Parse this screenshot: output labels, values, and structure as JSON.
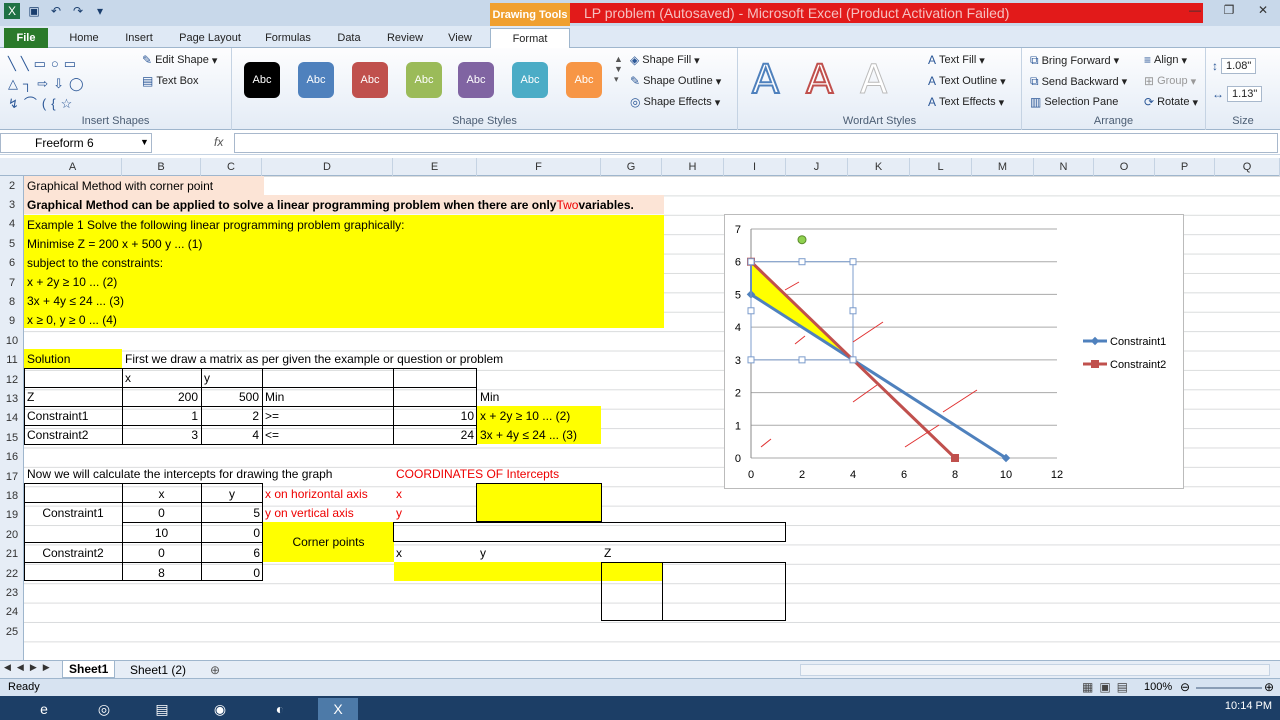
{
  "title": {
    "drawing_tools": "Drawing Tools",
    "window": "LP problem (Autosaved) - Microsoft Excel (Product Activation Failed)"
  },
  "tabs": [
    "File",
    "Home",
    "Insert",
    "Page Layout",
    "Formulas",
    "Data",
    "Review",
    "View",
    "Format"
  ],
  "ribbon": {
    "insert_shapes": {
      "label": "Insert Shapes",
      "edit_shape": "Edit Shape",
      "text_box": "Text Box"
    },
    "shape_styles": {
      "label": "Shape Styles",
      "samples": [
        "Abc",
        "Abc",
        "Abc",
        "Abc",
        "Abc",
        "Abc",
        "Abc"
      ],
      "colors": [
        "#000000",
        "#4f81bd",
        "#c0504d",
        "#9bbb59",
        "#8064a2",
        "#4bacc6",
        "#f79646"
      ],
      "shape_fill": "Shape Fill",
      "shape_outline": "Shape Outline",
      "shape_effects": "Shape Effects"
    },
    "wordart": {
      "label": "WordArt Styles",
      "text_fill": "Text Fill",
      "text_outline": "Text Outline",
      "text_effects": "Text Effects"
    },
    "arrange": {
      "label": "Arrange",
      "bring_forward": "Bring Forward",
      "send_backward": "Send Backward",
      "selection_pane": "Selection Pane",
      "align": "Align",
      "group": "Group",
      "rotate": "Rotate"
    },
    "size": {
      "label": "Size",
      "height": "1.08\"",
      "width": "1.13\""
    }
  },
  "namebox": "Freeform 6",
  "fx": "fx",
  "columns": [
    "A",
    "B",
    "C",
    "D",
    "E",
    "F",
    "G",
    "H",
    "I",
    "J",
    "K",
    "L",
    "M",
    "N",
    "O",
    "P",
    "Q"
  ],
  "rows": [
    "2",
    "3",
    "4",
    "5",
    "6",
    "7",
    "8",
    "9",
    "10",
    "11",
    "12",
    "13",
    "14",
    "15",
    "16",
    "17",
    "18",
    "19",
    "20",
    "21",
    "22",
    "23",
    "24",
    "25"
  ],
  "cells": {
    "a2": "Graphical Method with corner point",
    "a3_pre": "Graphical Method can be applied to solve a linear programming problem when there are only ",
    "a3_red": "Two",
    "a3_post": " variables.",
    "a4": "Example 1 Solve the following linear programming problem graphically:",
    "a5": "Minimise Z = 200 x + 500 y ... (1)",
    "a6": "subject to the constraints:",
    "a7": "x + 2y ≥ 10 ... (2)",
    "a8": "3x + 4y ≤ 24 ... (3)",
    "a9": "x ≥ 0, y ≥ 0 ... (4)",
    "a11": "Solution",
    "b11": "First we draw a matrix as per given the example or question or problem",
    "b12": "x",
    "c12": "y",
    "a13": "Z",
    "b13": "200",
    "c13": "500",
    "d13": "Min",
    "f13": "Min",
    "a14": "Constraint1",
    "b14": "1",
    "c14": "2",
    "d14": ">=",
    "e14": "10",
    "f14": "x + 2y ≥ 10 ... (2)",
    "a15": "Constraint2",
    "b15": "3",
    "c15": "4",
    "d15": "<=",
    "e15": "24",
    "f15": "3x + 4y ≤ 24 ... (3)",
    "a17": "Now we will calculate the intercepts for drawing the graph",
    "e17": "COORDINATES OF Intercepts",
    "b18": "x",
    "c18": "y",
    "d18": "x on horizontal axis",
    "e18": "x",
    "a19": "Constraint1",
    "b19": "0",
    "c19": "5",
    "d19": "y on vertical axis",
    "e19": "y",
    "b20": "10",
    "c20": "0",
    "d20": "Corner points",
    "a21": "Constraint2",
    "b21": "0",
    "c21": "6",
    "e21": "x",
    "f21": "y",
    "g21": "Z",
    "b22": "8",
    "c22": "0"
  },
  "chart_data": {
    "type": "line",
    "series": [
      {
        "name": "Constraint1",
        "points": [
          [
            0,
            5
          ],
          [
            10,
            0
          ]
        ],
        "color": "#4f81bd"
      },
      {
        "name": "Constraint2",
        "points": [
          [
            0,
            6
          ],
          [
            8,
            0
          ]
        ],
        "color": "#c0504d"
      }
    ],
    "xlim": [
      0,
      12
    ],
    "ylim": [
      0,
      7
    ],
    "xticks": [
      "0",
      "2",
      "4",
      "6",
      "8",
      "10",
      "12"
    ],
    "yticks": [
      "0",
      "1",
      "2",
      "3",
      "4",
      "5",
      "6",
      "7"
    ],
    "legend": "right",
    "feasible_region": [
      [
        0,
        6
      ],
      [
        0,
        5
      ],
      [
        4,
        3
      ]
    ],
    "region_color": "#ffff00"
  },
  "sheets": [
    "Sheet1",
    "Sheet1 (2)"
  ],
  "status": {
    "ready": "Ready",
    "zoom": "100%"
  },
  "clock": "10:14 PM"
}
